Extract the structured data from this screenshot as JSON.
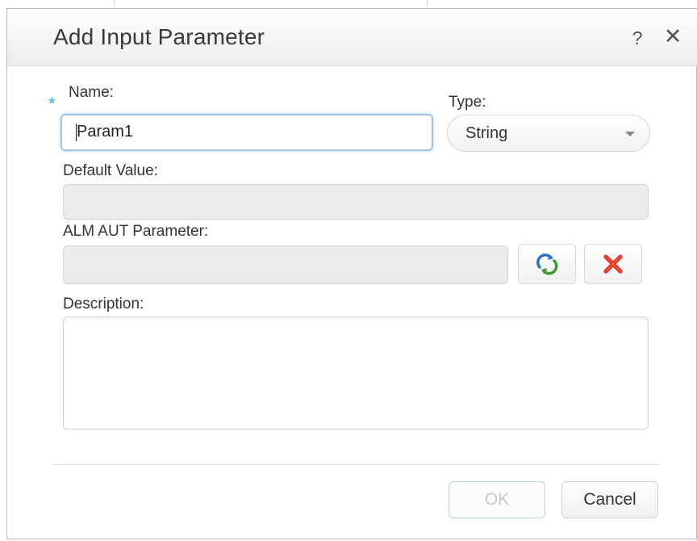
{
  "dialog": {
    "title": "Add Input Parameter",
    "help_icon": "question-mark-icon",
    "close_icon": "close-icon",
    "help_glyph": "?",
    "close_glyph": "✕"
  },
  "form": {
    "required_marker": "*",
    "name_label": "Name:",
    "name_value": "Param1",
    "type_label": "Type:",
    "type_value": "String",
    "default_value_label": "Default Value:",
    "default_value": "",
    "alm_aut_label": "ALM AUT Parameter:",
    "alm_aut_value": "",
    "description_label": "Description:",
    "description_value": ""
  },
  "icons": {
    "select_parameter": "refresh-arrows-icon",
    "clear_parameter": "red-x-icon"
  },
  "buttons": {
    "ok_label": "OK",
    "cancel_label": "Cancel"
  },
  "colors": {
    "focus_border": "#9fc4e8",
    "required_star": "#3aa6e6",
    "clear_icon_red": "#e0301e",
    "refresh_green": "#3a9a2b",
    "refresh_blue": "#2b6fc6"
  }
}
